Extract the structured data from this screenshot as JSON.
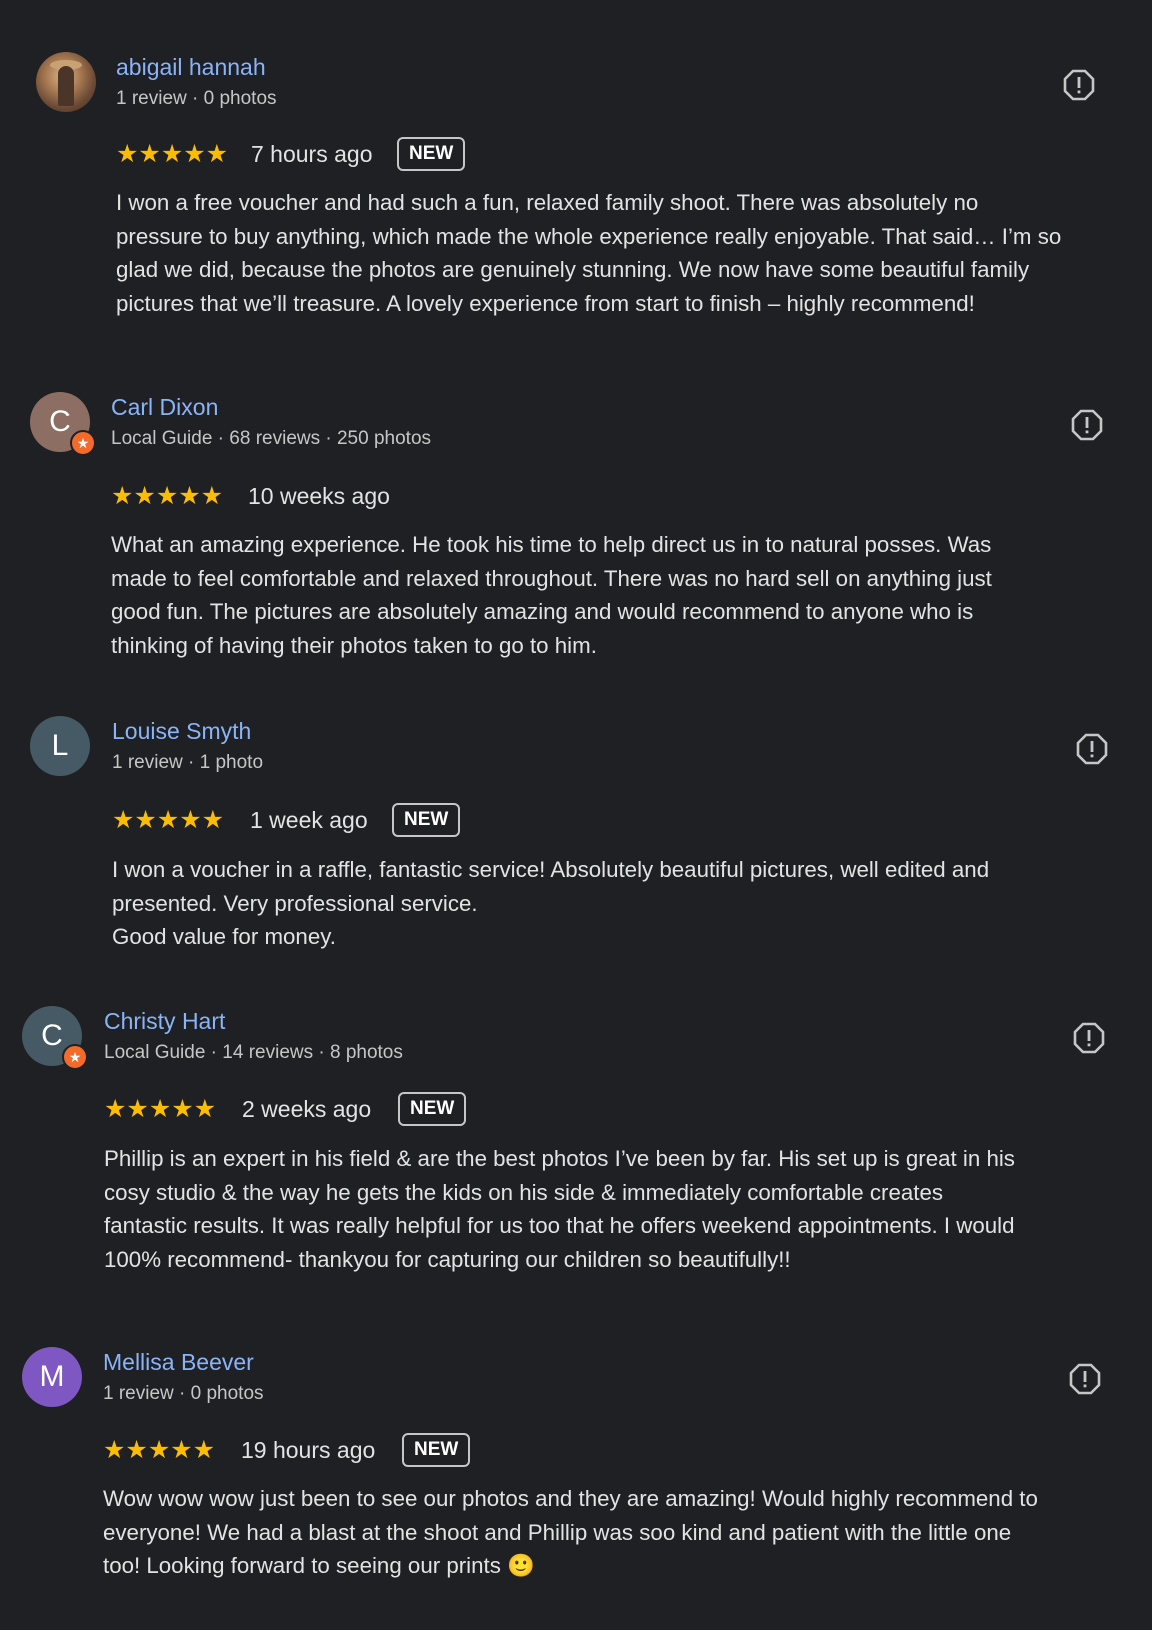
{
  "colors": {
    "background": "#1f2023",
    "name_link": "#8ab4f8",
    "star": "#fbbc04",
    "local_guide_badge": "#f26b2a"
  },
  "icons": {
    "report": "flag-report-icon",
    "rating": "star-icon",
    "local_guide": "local-guide-star-icon"
  },
  "reviews": [
    {
      "name": "abigail hannah",
      "meta": "1 review · 0 photos",
      "avatar_type": "photo",
      "avatar_letter": "",
      "avatar_color": "#8a6446",
      "local_guide": false,
      "rating": 5,
      "stars": "★★★★★",
      "time": "7 hours ago",
      "badge": "NEW",
      "text": "I won a free voucher and had such a fun, relaxed family shoot. There was absolutely no\npressure to buy anything, which made the whole experience really enjoyable. That said… I’m so\nglad we did, because the photos are genuinely stunning. We now have some beautiful family\npictures that we’ll treasure. A lovely experience from start to finish – highly recommend!"
    },
    {
      "name": "Carl Dixon",
      "meta": "Local Guide · 68 reviews · 250 photos",
      "avatar_type": "letter",
      "avatar_letter": "C",
      "avatar_color": "#8d6e63",
      "local_guide": true,
      "rating": 5,
      "stars": "★★★★★",
      "time": "10 weeks ago",
      "badge": "",
      "text": "What an amazing experience. He took his time to help direct us in to natural posses. Was\nmade to feel comfortable and relaxed throughout. There was no hard sell on anything just\ngood fun. The pictures are absolutely amazing and would recommend to anyone who is\nthinking of having their photos taken to go to him."
    },
    {
      "name": "Louise Smyth",
      "meta": "1 review · 1 photo",
      "avatar_type": "letter",
      "avatar_letter": "L",
      "avatar_color": "#455a64",
      "local_guide": false,
      "rating": 5,
      "stars": "★★★★★",
      "time": "1 week ago",
      "badge": "NEW",
      "text": "I won a voucher in a raffle, fantastic service! Absolutely beautiful pictures, well edited and\npresented. Very professional service.\nGood value for money."
    },
    {
      "name": "Christy Hart",
      "meta": "Local Guide · 14 reviews · 8 photos",
      "avatar_type": "letter",
      "avatar_letter": "C",
      "avatar_color": "#455a64",
      "local_guide": true,
      "rating": 5,
      "stars": "★★★★★",
      "time": "2 weeks ago",
      "badge": "NEW",
      "text": "Phillip is an expert in his field & are the best photos I’ve been by far. His set up is great in his\ncosy studio & the way he gets the kids on his side & immediately comfortable creates\nfantastic results. It was really helpful for us too that he offers weekend appointments. I would\n100% recommend- thankyou for capturing our children so beautifully!!"
    },
    {
      "name": "Mellisa Beever",
      "meta": "1 review · 0 photos",
      "avatar_type": "letter",
      "avatar_letter": "M",
      "avatar_color": "#7e57c2",
      "local_guide": false,
      "rating": 5,
      "stars": "★★★★★",
      "time": "19 hours ago",
      "badge": "NEW",
      "text": "Wow wow wow just been to see our photos and they are amazing! Would highly recommend to\neveryone! We had a blast at the shoot and Phillip was soo kind and patient with the little one\ntoo! Looking forward to seeing our prints 🙂"
    }
  ]
}
